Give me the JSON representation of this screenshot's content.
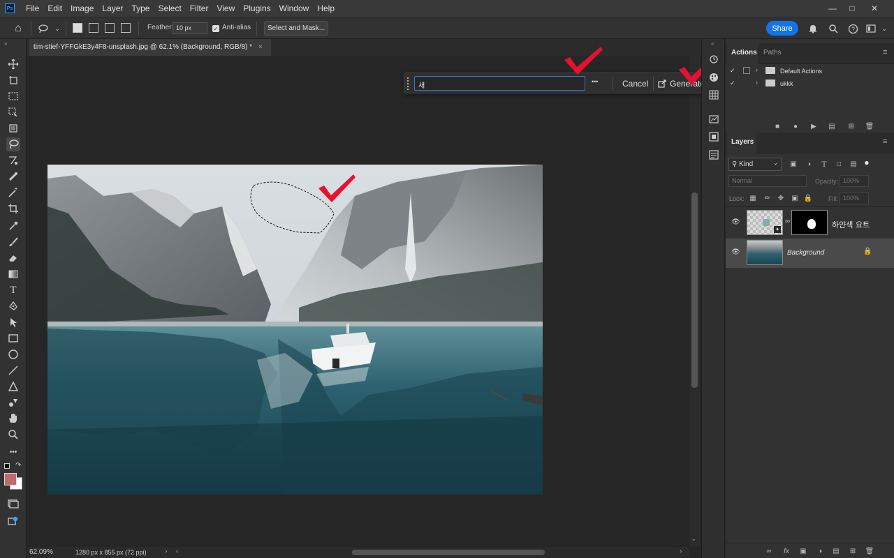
{
  "menubar": {
    "logo": "Ps",
    "items": [
      "File",
      "Edit",
      "Image",
      "Layer",
      "Type",
      "Select",
      "Filter",
      "View",
      "Plugins",
      "Window",
      "Help"
    ]
  },
  "options": {
    "feather_label": "Feather:",
    "feather_value": "10 px",
    "antialias_label": "Anti-alias",
    "antialias_checked": true,
    "select_mask_label": "Select and Mask...",
    "share_label": "Share"
  },
  "document": {
    "tab_title": "tim-stief-YFFGkE3y4F8-unsplash.jpg @ 62.1% (Background, RGB/8) *",
    "zoom": "62.09%",
    "dimensions": "1280 px x 855 px (72 ppi)"
  },
  "generate_bar": {
    "prompt_value": "새",
    "cancel_label": "Cancel",
    "generate_label": "Generate",
    "more_label": "•••"
  },
  "actions_panel": {
    "tabs": [
      "Actions",
      "Paths"
    ],
    "items": [
      {
        "label": "Default Actions"
      },
      {
        "label": "ukkk"
      }
    ]
  },
  "layers_panel": {
    "tab": "Layers",
    "kind_label": "Kind",
    "blend_mode": "Normal",
    "opacity_label": "Opacity:",
    "opacity_value": "100%",
    "lock_label": "Lock:",
    "fill_label": "Fill:",
    "fill_value": "100%",
    "layers": [
      {
        "name": "하얀색 요트",
        "selected": false
      },
      {
        "name": "Background",
        "selected": true
      }
    ]
  },
  "colors": {
    "foreground": "#c0686f",
    "background": "#ffffff",
    "accent": "#1473e6",
    "checkmark": "#e8102f"
  }
}
